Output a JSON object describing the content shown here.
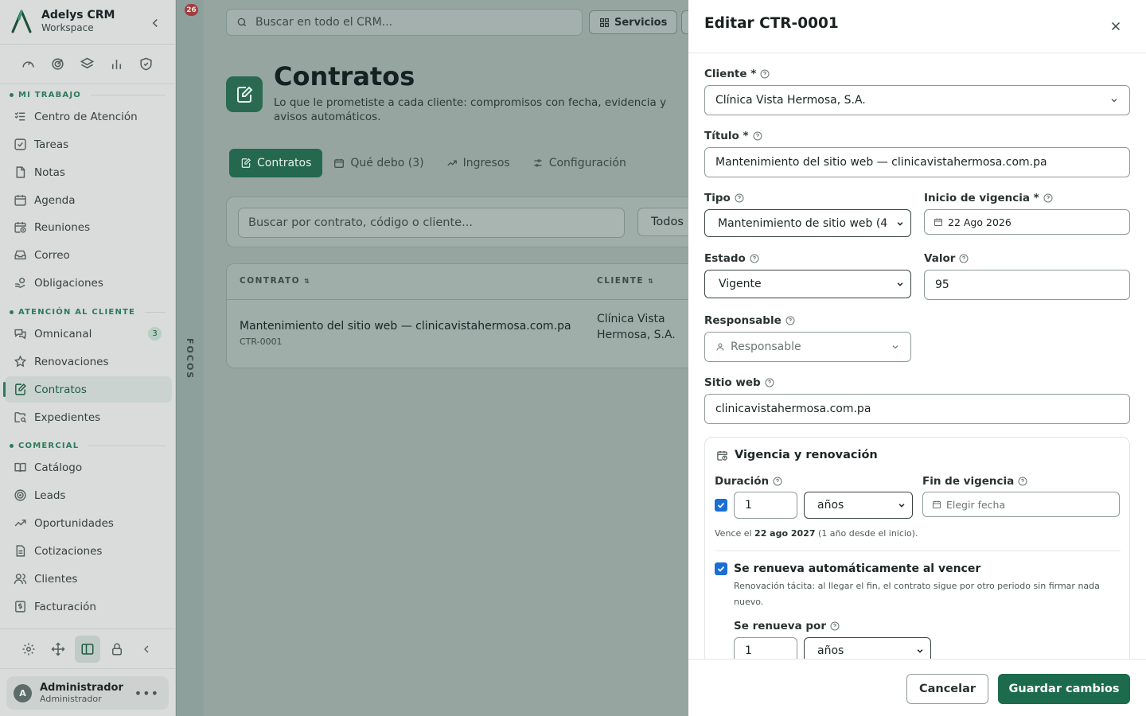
{
  "app": {
    "name": "Adelys CRM",
    "workspace": "Workspace",
    "notifications": "26"
  },
  "sidebar": {
    "sections": {
      "mi_trabajo": "MI TRABAJO",
      "atencion": "ATENCIÓN AL CLIENTE",
      "comercial": "COMERCIAL"
    },
    "items": [
      {
        "label": "Centro de Atención",
        "icon": "list-check-icon"
      },
      {
        "label": "Tareas",
        "icon": "checkbox-icon"
      },
      {
        "label": "Notas",
        "icon": "note-icon"
      },
      {
        "label": "Agenda",
        "icon": "calendar-icon"
      },
      {
        "label": "Reuniones",
        "icon": "calendar-clock-icon"
      },
      {
        "label": "Correo",
        "icon": "inbox-icon"
      },
      {
        "label": "Obligaciones",
        "icon": "hand-coins-icon"
      },
      {
        "label": "Omnicanal",
        "icon": "chat-icon",
        "badge": "3"
      },
      {
        "label": "Renovaciones",
        "icon": "star-icon"
      },
      {
        "label": "Contratos",
        "icon": "contract-icon",
        "active": true
      },
      {
        "label": "Expedientes",
        "icon": "folder-search-icon"
      },
      {
        "label": "Catálogo",
        "icon": "book-icon"
      },
      {
        "label": "Leads",
        "icon": "target-icon"
      },
      {
        "label": "Oportunidades",
        "icon": "trending-up-icon"
      },
      {
        "label": "Cotizaciones",
        "icon": "file-text-icon"
      },
      {
        "label": "Clientes",
        "icon": "users-icon"
      },
      {
        "label": "Facturación",
        "icon": "invoice-icon"
      }
    ],
    "user": {
      "initial": "A",
      "name": "Administrador",
      "role": "Administrador"
    }
  },
  "focos_label": "FOCOS",
  "topbar": {
    "search_placeholder": "Buscar en todo el CRM...",
    "services_label": "Servicios"
  },
  "page": {
    "title": "Contratos",
    "description": "Lo que le prometiste a cada cliente: compromisos con fecha, evidencia y avisos automáticos.",
    "tabs": [
      {
        "label": "Contratos",
        "active": true
      },
      {
        "label": "Qué debo (3)"
      },
      {
        "label": "Ingresos"
      },
      {
        "label": "Configuración"
      }
    ],
    "filter": {
      "search_placeholder": "Buscar por contrato, código o cliente...",
      "status": "Todos"
    },
    "table": {
      "headers": [
        "CONTRATO",
        "CLIENTE"
      ],
      "rows": [
        {
          "title": "Mantenimiento del sitio web — clinicavistahermosa.com.pa",
          "code": "CTR-0001",
          "client": "Clínica Vista Hermosa, S.A."
        }
      ]
    }
  },
  "drawer": {
    "title": "Editar CTR-0001",
    "cliente": {
      "label": "Cliente *",
      "value": "Clínica Vista Hermosa, S.A."
    },
    "titulo": {
      "label": "Título *",
      "value": "Mantenimiento del sitio web — clinicavistahermosa.com.pa"
    },
    "tipo": {
      "label": "Tipo",
      "value": "Mantenimiento de sitio web (4"
    },
    "inicio": {
      "label": "Inicio de vigencia *",
      "value": "22 Ago 2026"
    },
    "estado": {
      "label": "Estado",
      "value": "Vigente"
    },
    "valor": {
      "label": "Valor",
      "value": "95"
    },
    "responsable": {
      "label": "Responsable",
      "placeholder": "Responsable"
    },
    "sitio": {
      "label": "Sitio web",
      "value": "clinicavistahermosa.com.pa"
    },
    "vigencia": {
      "title": "Vigencia y renovación",
      "duracion_label": "Duración",
      "duracion_value": "1",
      "duracion_unit": "años",
      "fin_label": "Fin de vigencia",
      "fin_placeholder": "Elegir fecha",
      "vence_prefix": "Vence el",
      "vence_date": "22 ago 2027",
      "vence_suffix": "(1 año desde el inicio).",
      "renew_label": "Se renueva automáticamente al vencer",
      "renew_desc": "Renovación tácita: al llegar el fin, el contrato sigue por otro periodo sin firmar nada nuevo.",
      "renew_by_label": "Se renueva por",
      "renew_by_value": "1",
      "renew_by_unit": "años"
    },
    "cancel_label": "Cancelar",
    "save_label": "Guardar cambios"
  }
}
